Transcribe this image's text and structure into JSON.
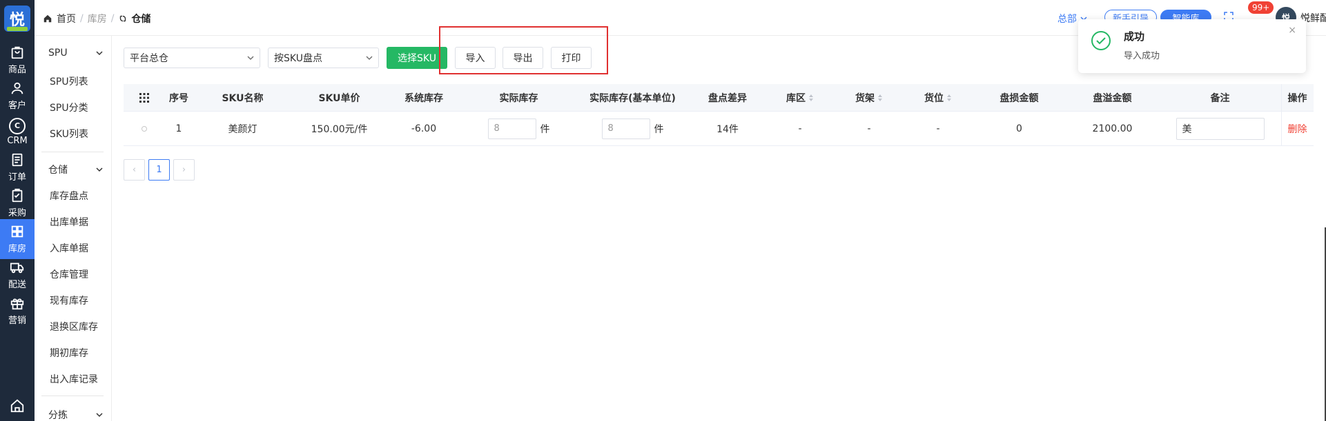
{
  "rail": {
    "items": [
      {
        "label": "商品",
        "icon": "bag-icon"
      },
      {
        "label": "客户",
        "icon": "user-icon"
      },
      {
        "label": "CRM",
        "icon": "crm-icon"
      },
      {
        "label": "订单",
        "icon": "document-icon"
      },
      {
        "label": "采购",
        "icon": "clipboard-icon"
      },
      {
        "label": "库房",
        "icon": "grid-icon",
        "active": true
      },
      {
        "label": "配送",
        "icon": "truck-icon"
      },
      {
        "label": "营销",
        "icon": "gift-icon"
      }
    ]
  },
  "header": {
    "breadcrumb": {
      "home": "首页",
      "middle": "库房",
      "current": "仓储"
    },
    "dept": "总部",
    "pill_outline": "新手引导",
    "pill_solid": "智能库",
    "badge": "99+",
    "user": "悦鲜配送"
  },
  "subnav": {
    "group1": "SPU",
    "group1_items": [
      "SPU列表",
      "SPU分类",
      "SKU列表"
    ],
    "group2": "仓储",
    "group2_items": [
      "库存盘点",
      "出库单据",
      "入库单据",
      "仓库管理",
      "现有库存",
      "退换区库存",
      "期初库存",
      "出入库记录"
    ],
    "group3": "分拣"
  },
  "toolbar": {
    "warehouse": "平台总仓",
    "mode": "按SKU盘点",
    "select_sku": "选择SKU",
    "import": "导入",
    "export": "导出",
    "print": "打印"
  },
  "table": {
    "headers": {
      "index": "序号",
      "sku_name": "SKU名称",
      "sku_price": "SKU单价",
      "system_stock": "系统库存",
      "actual_stock": "实际库存",
      "actual_base": "实际库存(基本单位)",
      "diff": "盘点差异",
      "area": "库区",
      "shelf": "货架",
      "slot": "货位",
      "loss": "盘损金额",
      "surplus": "盘溢金额",
      "note": "备注",
      "op": "操作"
    },
    "row": {
      "index": "1",
      "sku_name": "美颜灯",
      "sku_price": "150.00元/件",
      "system_stock": "-6.00",
      "actual_stock": "8",
      "actual_unit": "件",
      "actual_base": "8",
      "actual_base_unit": "件",
      "diff": "14件",
      "area": "-",
      "shelf": "-",
      "slot": "-",
      "loss": "0",
      "surplus": "2100.00",
      "note": "美",
      "delete": "删除"
    }
  },
  "pagination": {
    "prev": "‹",
    "page": "1",
    "next": "›"
  },
  "toast": {
    "title": "成功",
    "message": "导入成功",
    "close": "×"
  },
  "colors": {
    "accent": "#3d7bf4",
    "success": "#25b864",
    "danger": "#f04134",
    "highlight": "#e03030"
  }
}
